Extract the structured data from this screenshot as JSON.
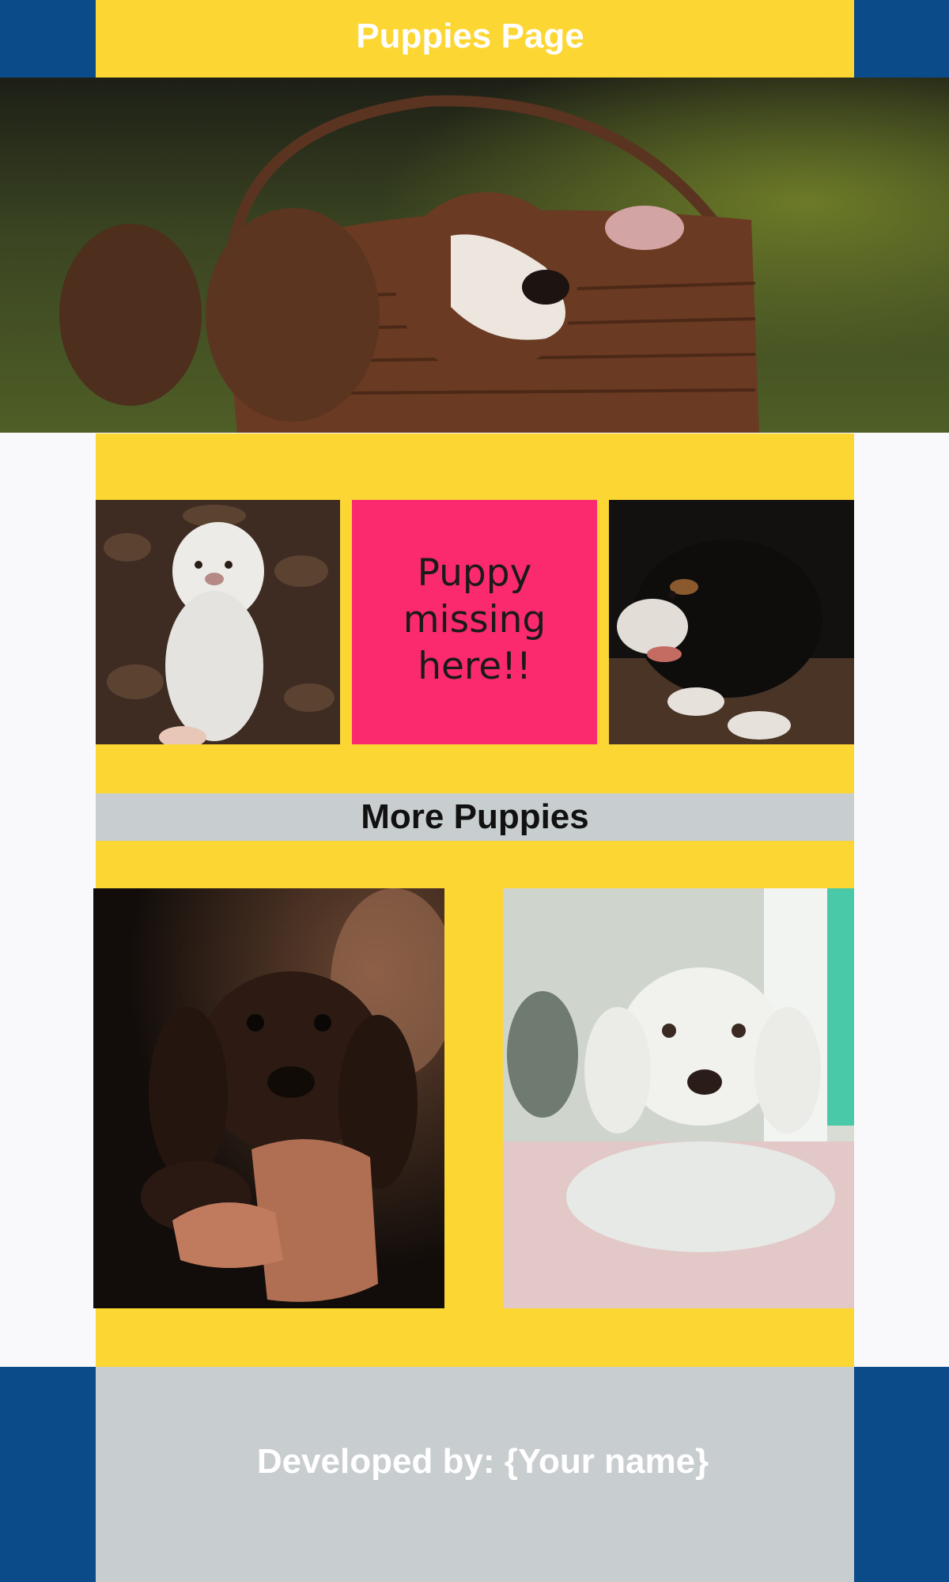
{
  "header": {
    "title": "Puppies Page"
  },
  "gallery": {
    "missing_tile_text": "Puppy missing here!!"
  },
  "more_section": {
    "title": "More Puppies"
  },
  "footer": {
    "credit": "Developed by: {Your name}"
  },
  "images": {
    "hero": "three-puppies-in-basket-photo",
    "tile_left": "white-fluffy-puppy-photo",
    "tile_right": "black-tricolor-puppy-photo",
    "bottom_left": "chocolate-spaniel-puppy-photo",
    "bottom_right": "white-poodle-dog-photo"
  },
  "colors": {
    "brand_blue": "#0b4b8a",
    "brand_yellow": "#fcd633",
    "accent_pink": "#fb2a6f",
    "neutral_gray": "#c8cdcf",
    "page_bg": "#f9f9fb"
  }
}
